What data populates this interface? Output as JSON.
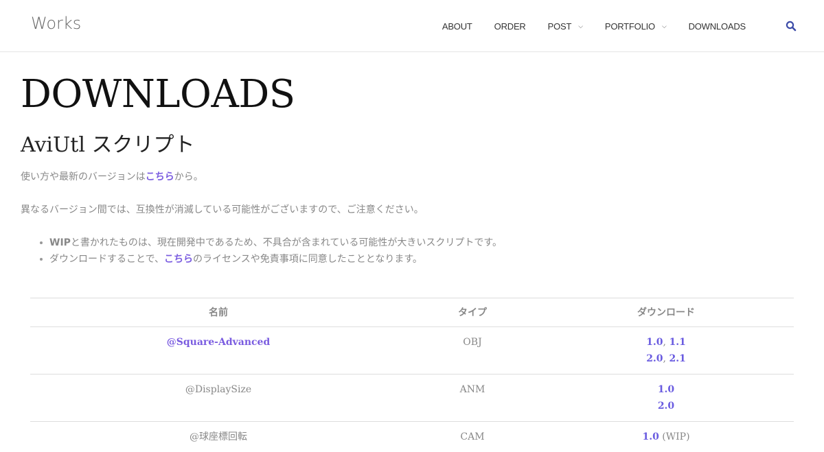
{
  "header": {
    "logo": "Works",
    "nav": [
      {
        "label": "ABOUT",
        "dropdown": false
      },
      {
        "label": "ORDER",
        "dropdown": false
      },
      {
        "label": "POST",
        "dropdown": true
      },
      {
        "label": "PORTFOLIO",
        "dropdown": true
      },
      {
        "label": "DOWNLOADS",
        "dropdown": false
      }
    ],
    "search_icon": "search-icon",
    "accent_color": "#3b4ba8"
  },
  "page": {
    "title": "DOWNLOADS",
    "section_title": "AviUtl スクリプト",
    "intro_pre": "使い方や最新のバージョンは",
    "intro_link": "こちら",
    "intro_post": "から。",
    "compat_note": "異なるバージョン間では、互換性が消滅している可能性がございますので、ご注意ください。",
    "notes": {
      "wip_bold": "WIP",
      "wip_text": "と書かれたものは、現在開発中であるため、不具合が含まれている可能性が大きいスクリプトです。",
      "license_pre": "ダウンロードすることで、",
      "license_link": "こちら",
      "license_post": "のライセンスや免責事項に同意したこととなります。"
    },
    "link_color": "#7a5ce0"
  },
  "table": {
    "headers": {
      "name": "名前",
      "type": "タイプ",
      "download": "ダウンロード"
    },
    "rows": [
      {
        "name": "@Square-Advanced",
        "name_is_link": true,
        "type": "OBJ",
        "lines": [
          [
            "1.0",
            "1.1"
          ],
          [
            "2.0",
            "2.1"
          ]
        ]
      },
      {
        "name": "@DisplaySize",
        "name_is_link": false,
        "type": "ANM",
        "lines": [
          [
            "1.0"
          ],
          [
            "2.0"
          ]
        ]
      },
      {
        "name": "@球座標回転",
        "name_is_link": false,
        "type": "CAM",
        "lines": [
          [
            "1.0"
          ]
        ],
        "suffix": "(WIP)"
      }
    ],
    "separator": ", "
  }
}
